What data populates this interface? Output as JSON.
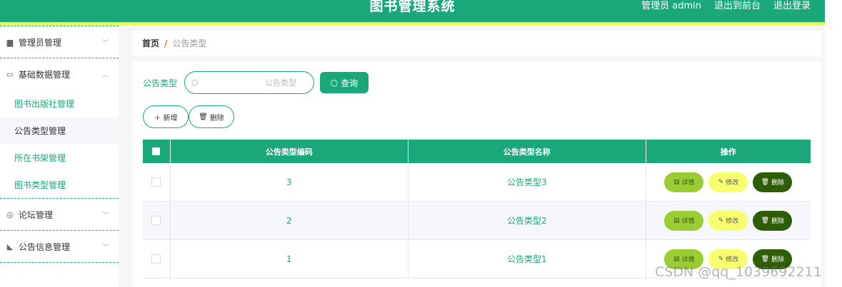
{
  "header": {
    "title": "图书管理系统",
    "user_label": "管理员 admin",
    "front_link": "退出到前台",
    "logout_link": "退出登录"
  },
  "sidebar": {
    "groups": [
      {
        "label": "管理员管理",
        "icon": "briefcase-icon",
        "expanded": false
      },
      {
        "label": "基础数据管理",
        "icon": "keyboard-icon",
        "expanded": true,
        "items": [
          {
            "label": "图书出版社管理",
            "active": false
          },
          {
            "label": "公告类型管理",
            "active": true
          },
          {
            "label": "所在书架管理",
            "active": false
          },
          {
            "label": "图书类型管理",
            "active": false
          }
        ]
      },
      {
        "label": "论坛管理",
        "icon": "compass-icon",
        "expanded": false
      },
      {
        "label": "公告信息管理",
        "icon": "megaphone-icon",
        "expanded": false
      }
    ]
  },
  "breadcrumb": {
    "home": "首页",
    "separator": "/",
    "current": "公告类型"
  },
  "search": {
    "label": "公告类型",
    "value": "",
    "placeholder": "公告类型",
    "button_label": "查询"
  },
  "actions": {
    "add_label": "新增",
    "delete_label": "删除"
  },
  "table": {
    "headers": [
      "公告类型编码",
      "公告类型名称",
      "操作"
    ],
    "rows": [
      {
        "code": "3",
        "name": "公告类型3"
      },
      {
        "code": "2",
        "name": "公告类型2"
      },
      {
        "code": "1",
        "name": "公告类型1"
      }
    ],
    "op_labels": {
      "detail": "详情",
      "edit": "修改",
      "delete": "删除"
    }
  },
  "watermark": "CSDN @qq_1039692211",
  "colors": {
    "primary": "#1aa87a",
    "accent_bar": "#f3f94a",
    "detail_btn": "#9acd32",
    "edit_btn": "#f7ff6f",
    "delete_btn": "#2d5e07"
  }
}
